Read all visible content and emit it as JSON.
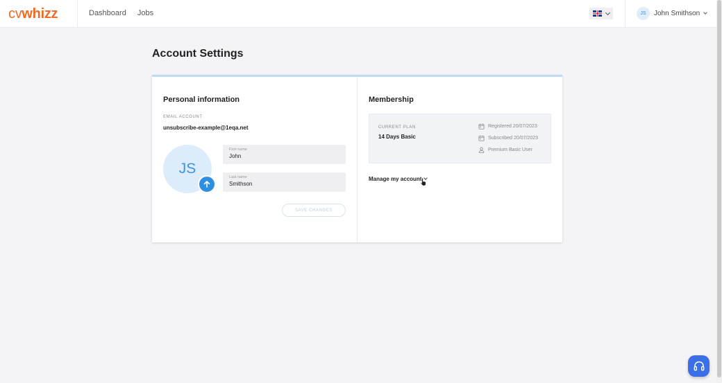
{
  "header": {
    "logo_cv": "cv",
    "logo_whizz": "whizz",
    "nav": [
      {
        "label": "Dashboard"
      },
      {
        "label": "Jobs"
      }
    ],
    "language_icon": "uk-flag-icon",
    "user": {
      "initials": "JS",
      "name": "John Smithson"
    }
  },
  "page": {
    "title": "Account Settings"
  },
  "personal": {
    "title": "Personal information",
    "email_label": "EMAIL ACCOUNT",
    "email": "unsubscribe-example@1eqa.net",
    "avatar_initials": "JS",
    "first_name": {
      "placeholder": "First name",
      "value": "John"
    },
    "last_name": {
      "placeholder": "Last name",
      "value": "Smithson"
    },
    "save_label": "SAVE CHANGES"
  },
  "membership": {
    "title": "Membership",
    "plan_label": "CURRENT PLAN",
    "plan_name": "14 Days Basic",
    "registered": "Registered 20/07/2023",
    "subscribed": "Subscribed 20/07/2023",
    "user_type": "Premium Basic User",
    "manage_label": "Manage my account"
  },
  "colors": {
    "brand": "#f26a21",
    "accent": "#2d8fe0",
    "help": "#3b6fe8"
  }
}
